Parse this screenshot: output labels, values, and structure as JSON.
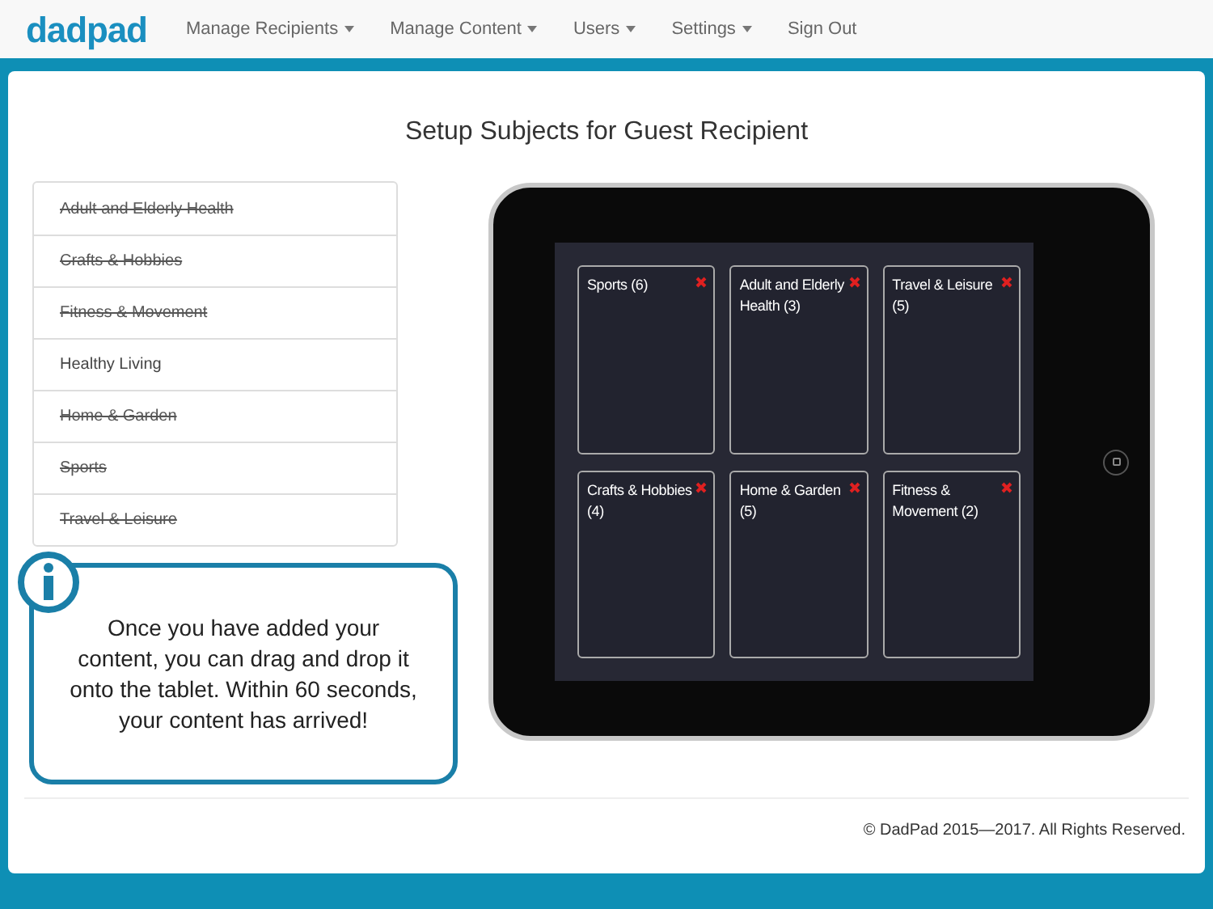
{
  "brand": "dadpad",
  "nav": [
    {
      "label": "Manage Recipients",
      "dropdown": true
    },
    {
      "label": "Manage Content",
      "dropdown": true
    },
    {
      "label": "Users",
      "dropdown": true
    },
    {
      "label": "Settings",
      "dropdown": true
    },
    {
      "label": "Sign Out",
      "dropdown": false
    }
  ],
  "title": "Setup Subjects for Guest Recipient",
  "subjects": [
    {
      "label": "Adult and Elderly Health",
      "added": true
    },
    {
      "label": "Crafts & Hobbies",
      "added": true
    },
    {
      "label": "Fitness & Movement",
      "added": true
    },
    {
      "label": "Healthy Living",
      "added": false
    },
    {
      "label": "Home & Garden",
      "added": true
    },
    {
      "label": "Sports",
      "added": true
    },
    {
      "label": "Travel & Leisure",
      "added": true
    }
  ],
  "callout": "Once you have added your content, you can drag and drop it onto the tablet.  Within 60 seconds, your content has arrived!",
  "tablet_tiles": [
    {
      "label": "Sports (6)"
    },
    {
      "label": "Adult and Elderly Health (3)"
    },
    {
      "label": "Travel & Leisure (5)"
    },
    {
      "label": "Crafts & Hobbies (4)"
    },
    {
      "label": "Home & Garden (5)"
    },
    {
      "label": "Fitness & Movement (2)"
    }
  ],
  "footer": "© DadPad 2015—2017. All Rights Reserved."
}
